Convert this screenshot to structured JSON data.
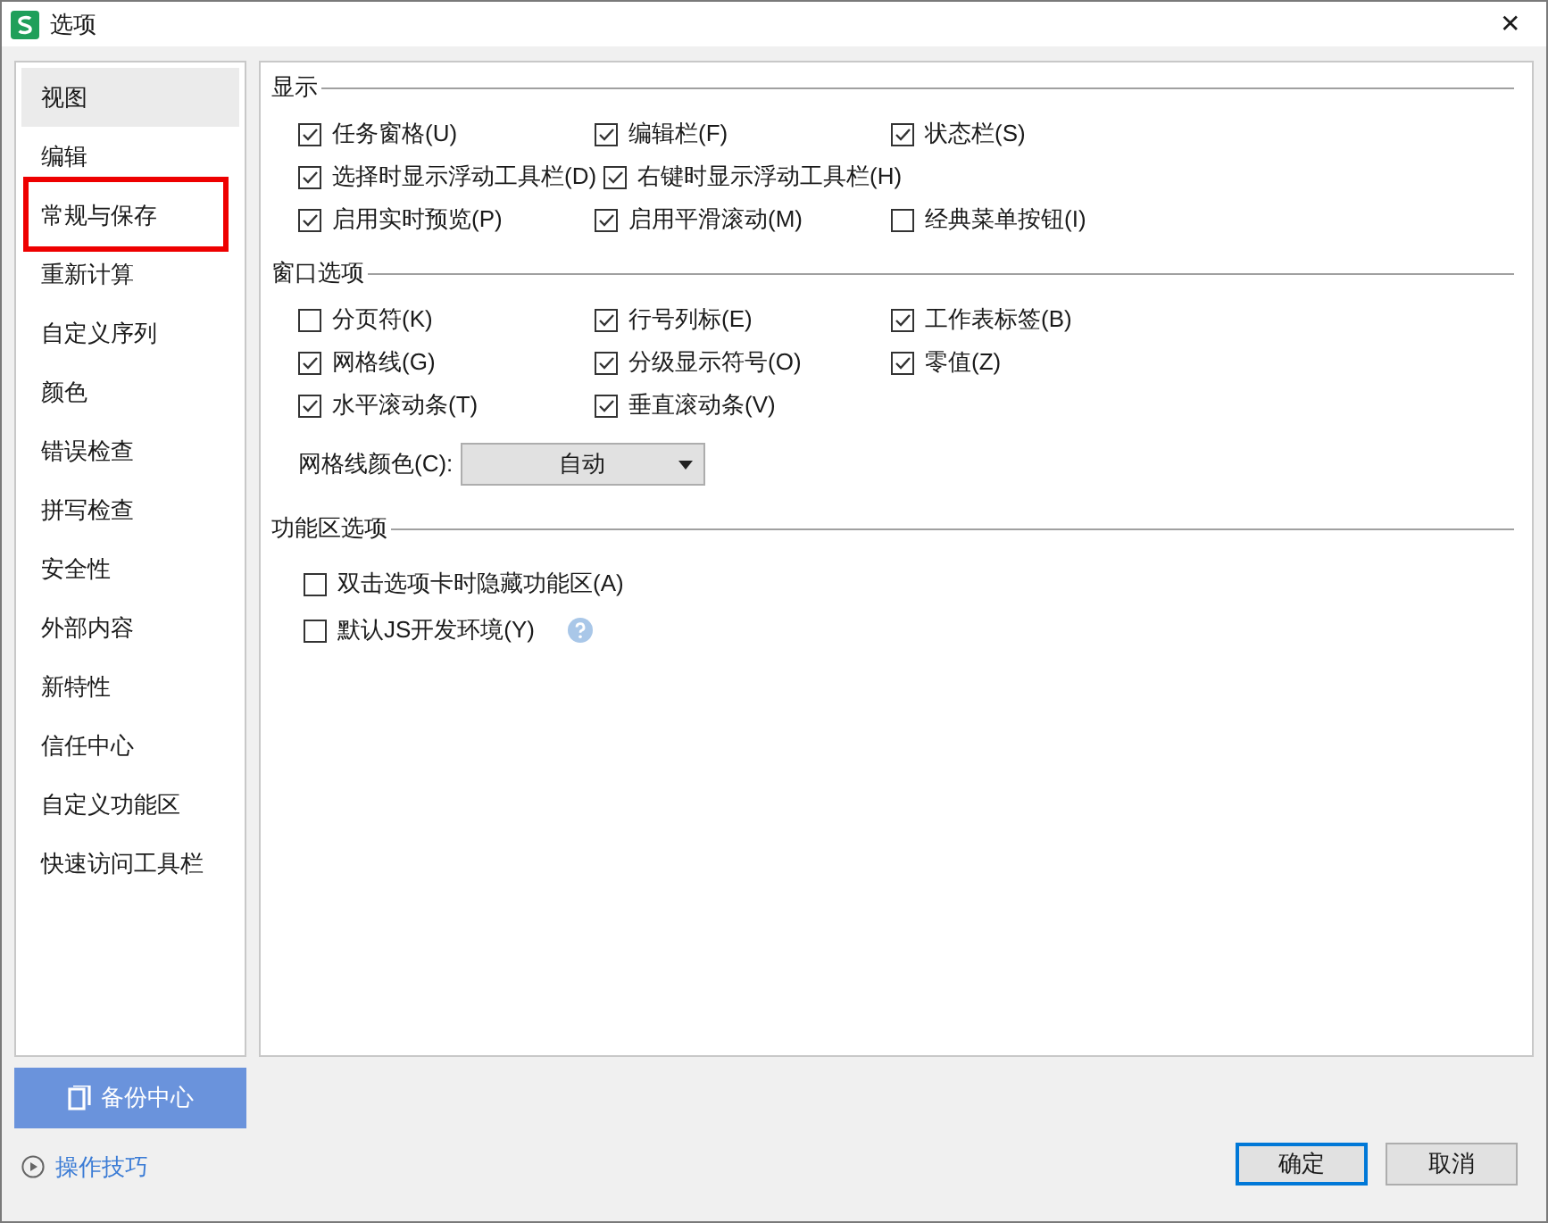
{
  "window": {
    "title": "选项",
    "close": "✕"
  },
  "sidebar": {
    "items": [
      {
        "label": "视图",
        "selected": true,
        "highlighted": false
      },
      {
        "label": "编辑",
        "selected": false,
        "highlighted": false
      },
      {
        "label": "常规与保存",
        "selected": false,
        "highlighted": true
      },
      {
        "label": "重新计算",
        "selected": false,
        "highlighted": false
      },
      {
        "label": "自定义序列",
        "selected": false,
        "highlighted": false
      },
      {
        "label": "颜色",
        "selected": false,
        "highlighted": false
      },
      {
        "label": "错误检查",
        "selected": false,
        "highlighted": false
      },
      {
        "label": "拼写检查",
        "selected": false,
        "highlighted": false
      },
      {
        "label": "安全性",
        "selected": false,
        "highlighted": false
      },
      {
        "label": "外部内容",
        "selected": false,
        "highlighted": false
      },
      {
        "label": "新特性",
        "selected": false,
        "highlighted": false
      },
      {
        "label": "信任中心",
        "selected": false,
        "highlighted": false
      },
      {
        "label": "自定义功能区",
        "selected": false,
        "highlighted": false
      },
      {
        "label": "快速访问工具栏",
        "selected": false,
        "highlighted": false
      }
    ]
  },
  "sections": [
    {
      "title": "显示",
      "kind": "grid",
      "rows": [
        [
          {
            "label": "任务窗格(U)",
            "checked": true
          },
          {
            "label": "编辑栏(F)",
            "checked": true
          },
          {
            "label": "状态栏(S)",
            "checked": true
          }
        ],
        [
          {
            "label": "选择时显示浮动工具栏(D)",
            "checked": true
          },
          {
            "label": "右键时显示浮动工具栏(H)",
            "checked": true
          }
        ],
        [
          {
            "label": "启用实时预览(P)",
            "checked": true
          },
          {
            "label": "启用平滑滚动(M)",
            "checked": true
          },
          {
            "label": "经典菜单按钮(I)",
            "checked": false
          }
        ]
      ]
    },
    {
      "title": "窗口选项",
      "kind": "grid",
      "rows": [
        [
          {
            "label": "分页符(K)",
            "checked": false
          },
          {
            "label": "行号列标(E)",
            "checked": true
          },
          {
            "label": "工作表标签(B)",
            "checked": true
          }
        ],
        [
          {
            "label": "网格线(G)",
            "checked": true
          },
          {
            "label": "分级显示符号(O)",
            "checked": true
          },
          {
            "label": "零值(Z)",
            "checked": true
          }
        ],
        [
          {
            "label": "水平滚动条(T)",
            "checked": true
          },
          {
            "label": "垂直滚动条(V)",
            "checked": true
          }
        ]
      ],
      "dropdown": {
        "label": "网格线颜色(C):",
        "value": "自动"
      }
    },
    {
      "title": "功能区选项",
      "kind": "list",
      "rows": [
        [
          {
            "label": "双击选项卡时隐藏功能区(A)",
            "checked": false,
            "help": false
          }
        ],
        [
          {
            "label": "默认JS开发环境(Y)",
            "checked": false,
            "help": true
          }
        ]
      ]
    }
  ],
  "backup_button": "备份中心",
  "tips_link": "操作技巧",
  "buttons": [
    {
      "label": "确定",
      "default": true
    },
    {
      "label": "取消",
      "default": false
    }
  ]
}
